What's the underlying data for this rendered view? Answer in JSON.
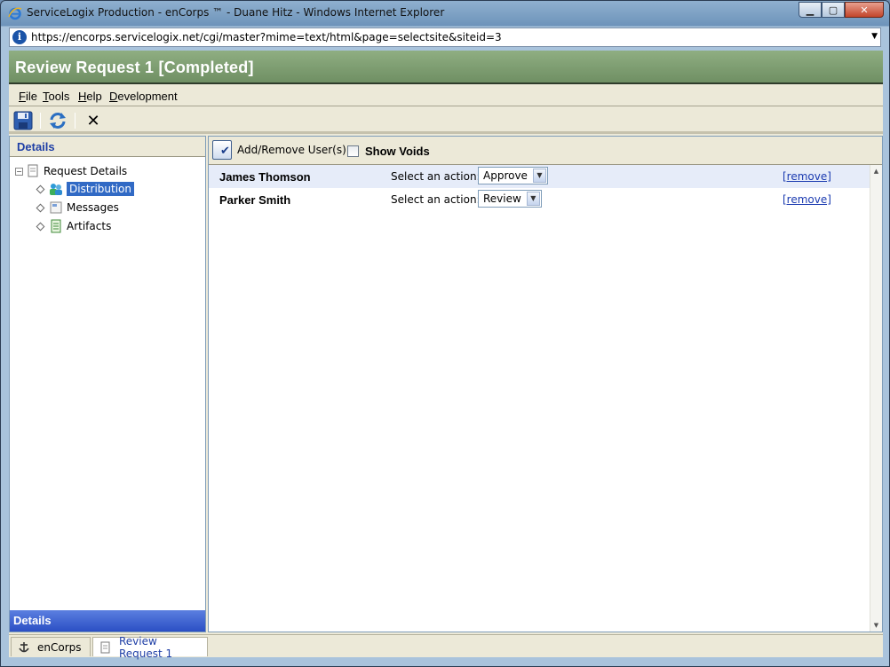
{
  "window": {
    "title": "ServiceLogix Production - enCorps ™ - Duane Hitz - Windows Internet Explorer",
    "url": "https://encorps.servicelogix.net/cgi/master?mime=text/html&page=selectsite&siteid=3"
  },
  "app": {
    "header_title": "Review Request 1 [Completed]",
    "menu": [
      "File",
      "Tools",
      "Help",
      "Development"
    ]
  },
  "left_panel": {
    "header": "Details",
    "tree": {
      "root": "Request Details",
      "children": [
        "Distribution",
        "Messages",
        "Artifacts"
      ],
      "selected": "Distribution"
    },
    "footer": "Details"
  },
  "right_panel": {
    "add_remove_label": "Add/Remove User(s)",
    "show_voids_label": "Show Voids",
    "show_voids_checked": false,
    "users": [
      {
        "name": "James Thomson",
        "action_label": "Select an action:",
        "action": "Approve",
        "remove": "[remove]"
      },
      {
        "name": "Parker Smith",
        "action_label": "Select an action:",
        "action": "Review",
        "remove": "[remove]"
      }
    ]
  },
  "tabs": [
    {
      "label": "enCorps",
      "active": false
    },
    {
      "label": "Review Request 1",
      "active": true
    }
  ],
  "colors": {
    "header_green": "#7a9a6e",
    "selection_blue": "#316ac5",
    "link_blue": "#1a3ab0",
    "footer_blue": "#3a5fd0"
  }
}
